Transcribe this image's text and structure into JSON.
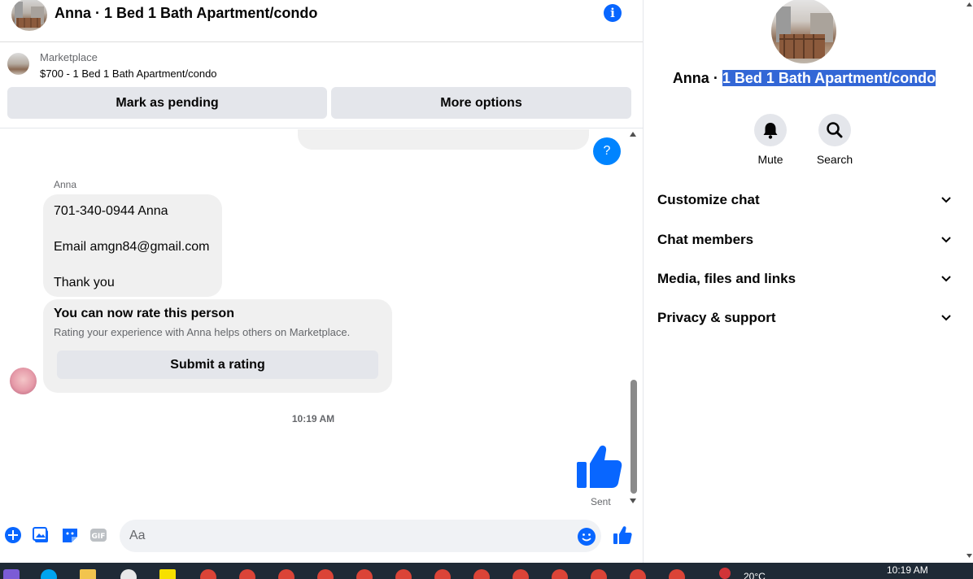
{
  "header": {
    "title": "Anna · 1 Bed 1 Bath Apartment/condo",
    "info_icon": "info-icon"
  },
  "marketplace": {
    "label": "Marketplace",
    "listing": "$700 - 1 Bed 1 Bath Apartment/condo",
    "mark_pending_label": "Mark as pending",
    "more_options_label": "More options"
  },
  "messages": {
    "sender_name": "Anna",
    "bubble_lines": [
      "701-340-0944 Anna",
      "Email amgn84@gmail.com",
      "Thank you"
    ],
    "rating": {
      "title": "You can now rate this person",
      "subtitle": "Rating your experience with Anna helps others on Marketplace.",
      "button": "Submit a rating"
    },
    "timestamp": "10:19 AM",
    "sent_status": "Sent",
    "unknown_avatar": "?"
  },
  "composer": {
    "placeholder": "Aa"
  },
  "info_panel": {
    "name_prefix": "Anna · ",
    "name_selected": "1 Bed 1 Bath Apartment/condo",
    "actions": [
      {
        "label": "Mute",
        "icon": "bell-icon"
      },
      {
        "label": "Search",
        "icon": "search-icon"
      }
    ],
    "sections": [
      "Customize chat",
      "Chat members",
      "Media, files and links",
      "Privacy & support"
    ]
  },
  "taskbar": {
    "clock": "10:19 AM",
    "temperature": "20°C"
  },
  "colors": {
    "accent": "#0866ff",
    "bubble": "#f0f0f0",
    "button": "#e4e6eb",
    "selection": "#3367d6",
    "taskbar": "#1f2a36"
  }
}
